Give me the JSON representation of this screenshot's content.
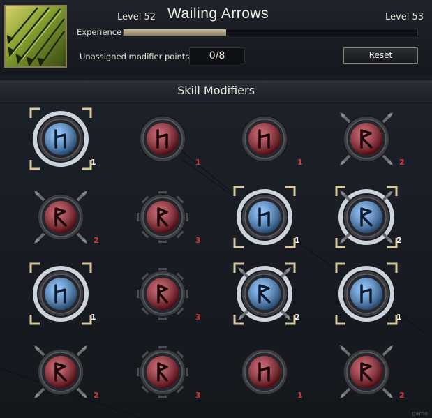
{
  "skill": {
    "name": "Wailing Arrows",
    "icon": "arrows-volley-icon",
    "level_current": "Level 52",
    "level_next": "Level 53"
  },
  "experience": {
    "label": "Experience",
    "progress": 0.35
  },
  "points": {
    "label": "Unassigned modifier points",
    "value": "0/8"
  },
  "reset_label": "Reset",
  "section_title": "Skill Modifiers",
  "colors": {
    "active_rune": "#5aa9ff",
    "inactive_rune": "#b01a2a",
    "active_cost": "#f2f2f2",
    "inactive_cost": "#d8323a",
    "frame_gold": "#d9c9a0"
  },
  "modifiers": [
    {
      "row": 0,
      "col": 0,
      "rune": "h-rune-icon",
      "active": true,
      "crossed": false,
      "gear": false,
      "cost": "1"
    },
    {
      "row": 0,
      "col": 1,
      "rune": "h-rune-icon",
      "active": false,
      "crossed": false,
      "gear": false,
      "cost": "1"
    },
    {
      "row": 0,
      "col": 2,
      "rune": "h-rune-icon",
      "active": false,
      "crossed": false,
      "gear": false,
      "cost": "1"
    },
    {
      "row": 0,
      "col": 3,
      "rune": "a-rune-icon",
      "active": false,
      "crossed": true,
      "gear": false,
      "cost": "2"
    },
    {
      "row": 1,
      "col": 0,
      "rune": "a-rune-icon",
      "active": false,
      "crossed": true,
      "gear": false,
      "cost": "2"
    },
    {
      "row": 1,
      "col": 1,
      "rune": "r-rune-icon",
      "active": false,
      "crossed": false,
      "gear": true,
      "cost": "3"
    },
    {
      "row": 1,
      "col": 2,
      "rune": "h-rune-icon",
      "active": true,
      "crossed": false,
      "gear": false,
      "cost": "1"
    },
    {
      "row": 1,
      "col": 3,
      "rune": "a-rune-icon",
      "active": true,
      "crossed": true,
      "gear": false,
      "cost": "2"
    },
    {
      "row": 2,
      "col": 0,
      "rune": "h-rune-icon",
      "active": true,
      "crossed": false,
      "gear": false,
      "cost": "1"
    },
    {
      "row": 2,
      "col": 1,
      "rune": "r-rune-icon",
      "active": false,
      "crossed": false,
      "gear": true,
      "cost": "3"
    },
    {
      "row": 2,
      "col": 2,
      "rune": "a-rune-icon",
      "active": true,
      "crossed": true,
      "gear": false,
      "cost": "2"
    },
    {
      "row": 2,
      "col": 3,
      "rune": "h-rune-icon",
      "active": true,
      "crossed": false,
      "gear": false,
      "cost": "1"
    },
    {
      "row": 3,
      "col": 0,
      "rune": "a-rune-icon",
      "active": false,
      "crossed": true,
      "gear": false,
      "cost": "2"
    },
    {
      "row": 3,
      "col": 1,
      "rune": "r-rune-icon",
      "active": false,
      "crossed": false,
      "gear": true,
      "cost": "3"
    },
    {
      "row": 3,
      "col": 2,
      "rune": "h-rune-icon",
      "active": false,
      "crossed": false,
      "gear": false,
      "cost": "1"
    },
    {
      "row": 3,
      "col": 3,
      "rune": "a-rune-icon",
      "active": false,
      "crossed": true,
      "gear": false,
      "cost": "2"
    }
  ]
}
